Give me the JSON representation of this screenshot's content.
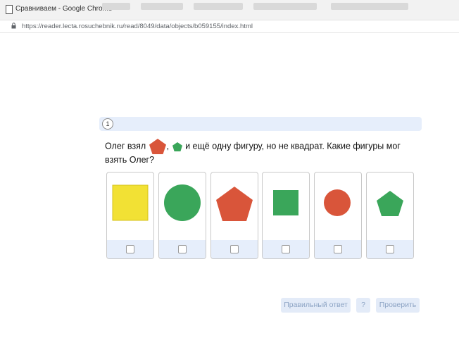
{
  "window": {
    "tab_title": "Сравниваем - Google Chrome"
  },
  "address_bar": {
    "url": "https://reader.lecta.rosuchebnik.ru/read/8049/data/objects/b059155/index.html"
  },
  "task": {
    "number": "1",
    "question_part1": "Олег взял",
    "question_part2": ",",
    "question_part3": "и ещё одну фигуру, но не квадрат. Какие фигуры мог взять Олег?",
    "inline_shapes": [
      {
        "shape": "pentagon",
        "color": "#d9553a"
      },
      {
        "shape": "pentagon",
        "color": "#3aa65a"
      }
    ],
    "options": [
      {
        "shape": "square",
        "color": "#f2e134",
        "checked": false
      },
      {
        "shape": "circle",
        "color": "#3aa65a",
        "checked": false
      },
      {
        "shape": "pentagon",
        "color": "#d9553a",
        "checked": false
      },
      {
        "shape": "square",
        "color": "#3aa65a",
        "checked": false
      },
      {
        "shape": "circle",
        "color": "#d9553a",
        "checked": false
      },
      {
        "shape": "pentagon",
        "color": "#3aa65a",
        "checked": false
      }
    ]
  },
  "buttons": {
    "correct_answer": "Правильный ответ",
    "help": "?",
    "check": "Проверить"
  }
}
